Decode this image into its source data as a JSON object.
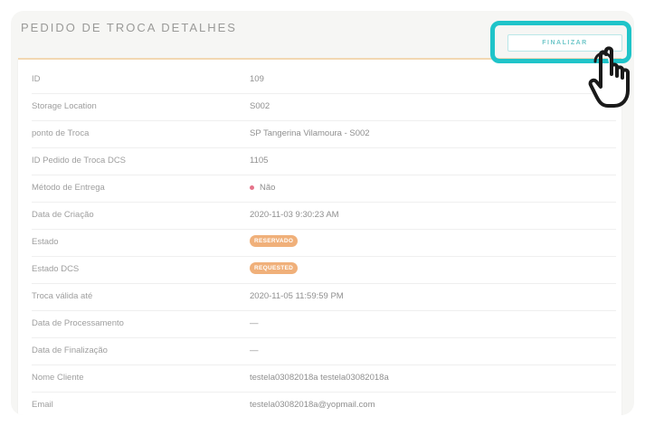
{
  "page": {
    "title": "PEDIDO DE TROCA DETALHES"
  },
  "actions": {
    "finalizar_label": "FINALIZAR"
  },
  "details": [
    {
      "label": "ID",
      "value": "109"
    },
    {
      "label": "Storage Location",
      "value": "S002"
    },
    {
      "label": "ponto de Troca",
      "value": "SP Tangerina Vilamoura - S002"
    },
    {
      "label": "ID Pedido de Troca DCS",
      "value": "1105"
    },
    {
      "label": "Método de Entrega",
      "value": "Não"
    },
    {
      "label": "Data de Criação",
      "value": "2020-11-03 9:30:23 AM"
    },
    {
      "label": "Estado",
      "value": "RESERVADO"
    },
    {
      "label": "Estado DCS",
      "value": "REQUESTED"
    },
    {
      "label": "Troca válida até",
      "value": "2020-11-05 11:59:59 PM"
    },
    {
      "label": "Data de Processamento",
      "value": "—"
    },
    {
      "label": "Data de Finalização",
      "value": "—"
    },
    {
      "label": "Nome Cliente",
      "value": "testela03082018a testela03082018a"
    },
    {
      "label": "Email",
      "value": "testela03082018a@yopmail.com"
    }
  ],
  "colors": {
    "highlight": "#1fc4c9",
    "badge": "#f0b07a",
    "status_dot": "#e5738a"
  },
  "icons": {
    "pointer": "hand-pointer-icon",
    "status": "status-dot-icon"
  }
}
